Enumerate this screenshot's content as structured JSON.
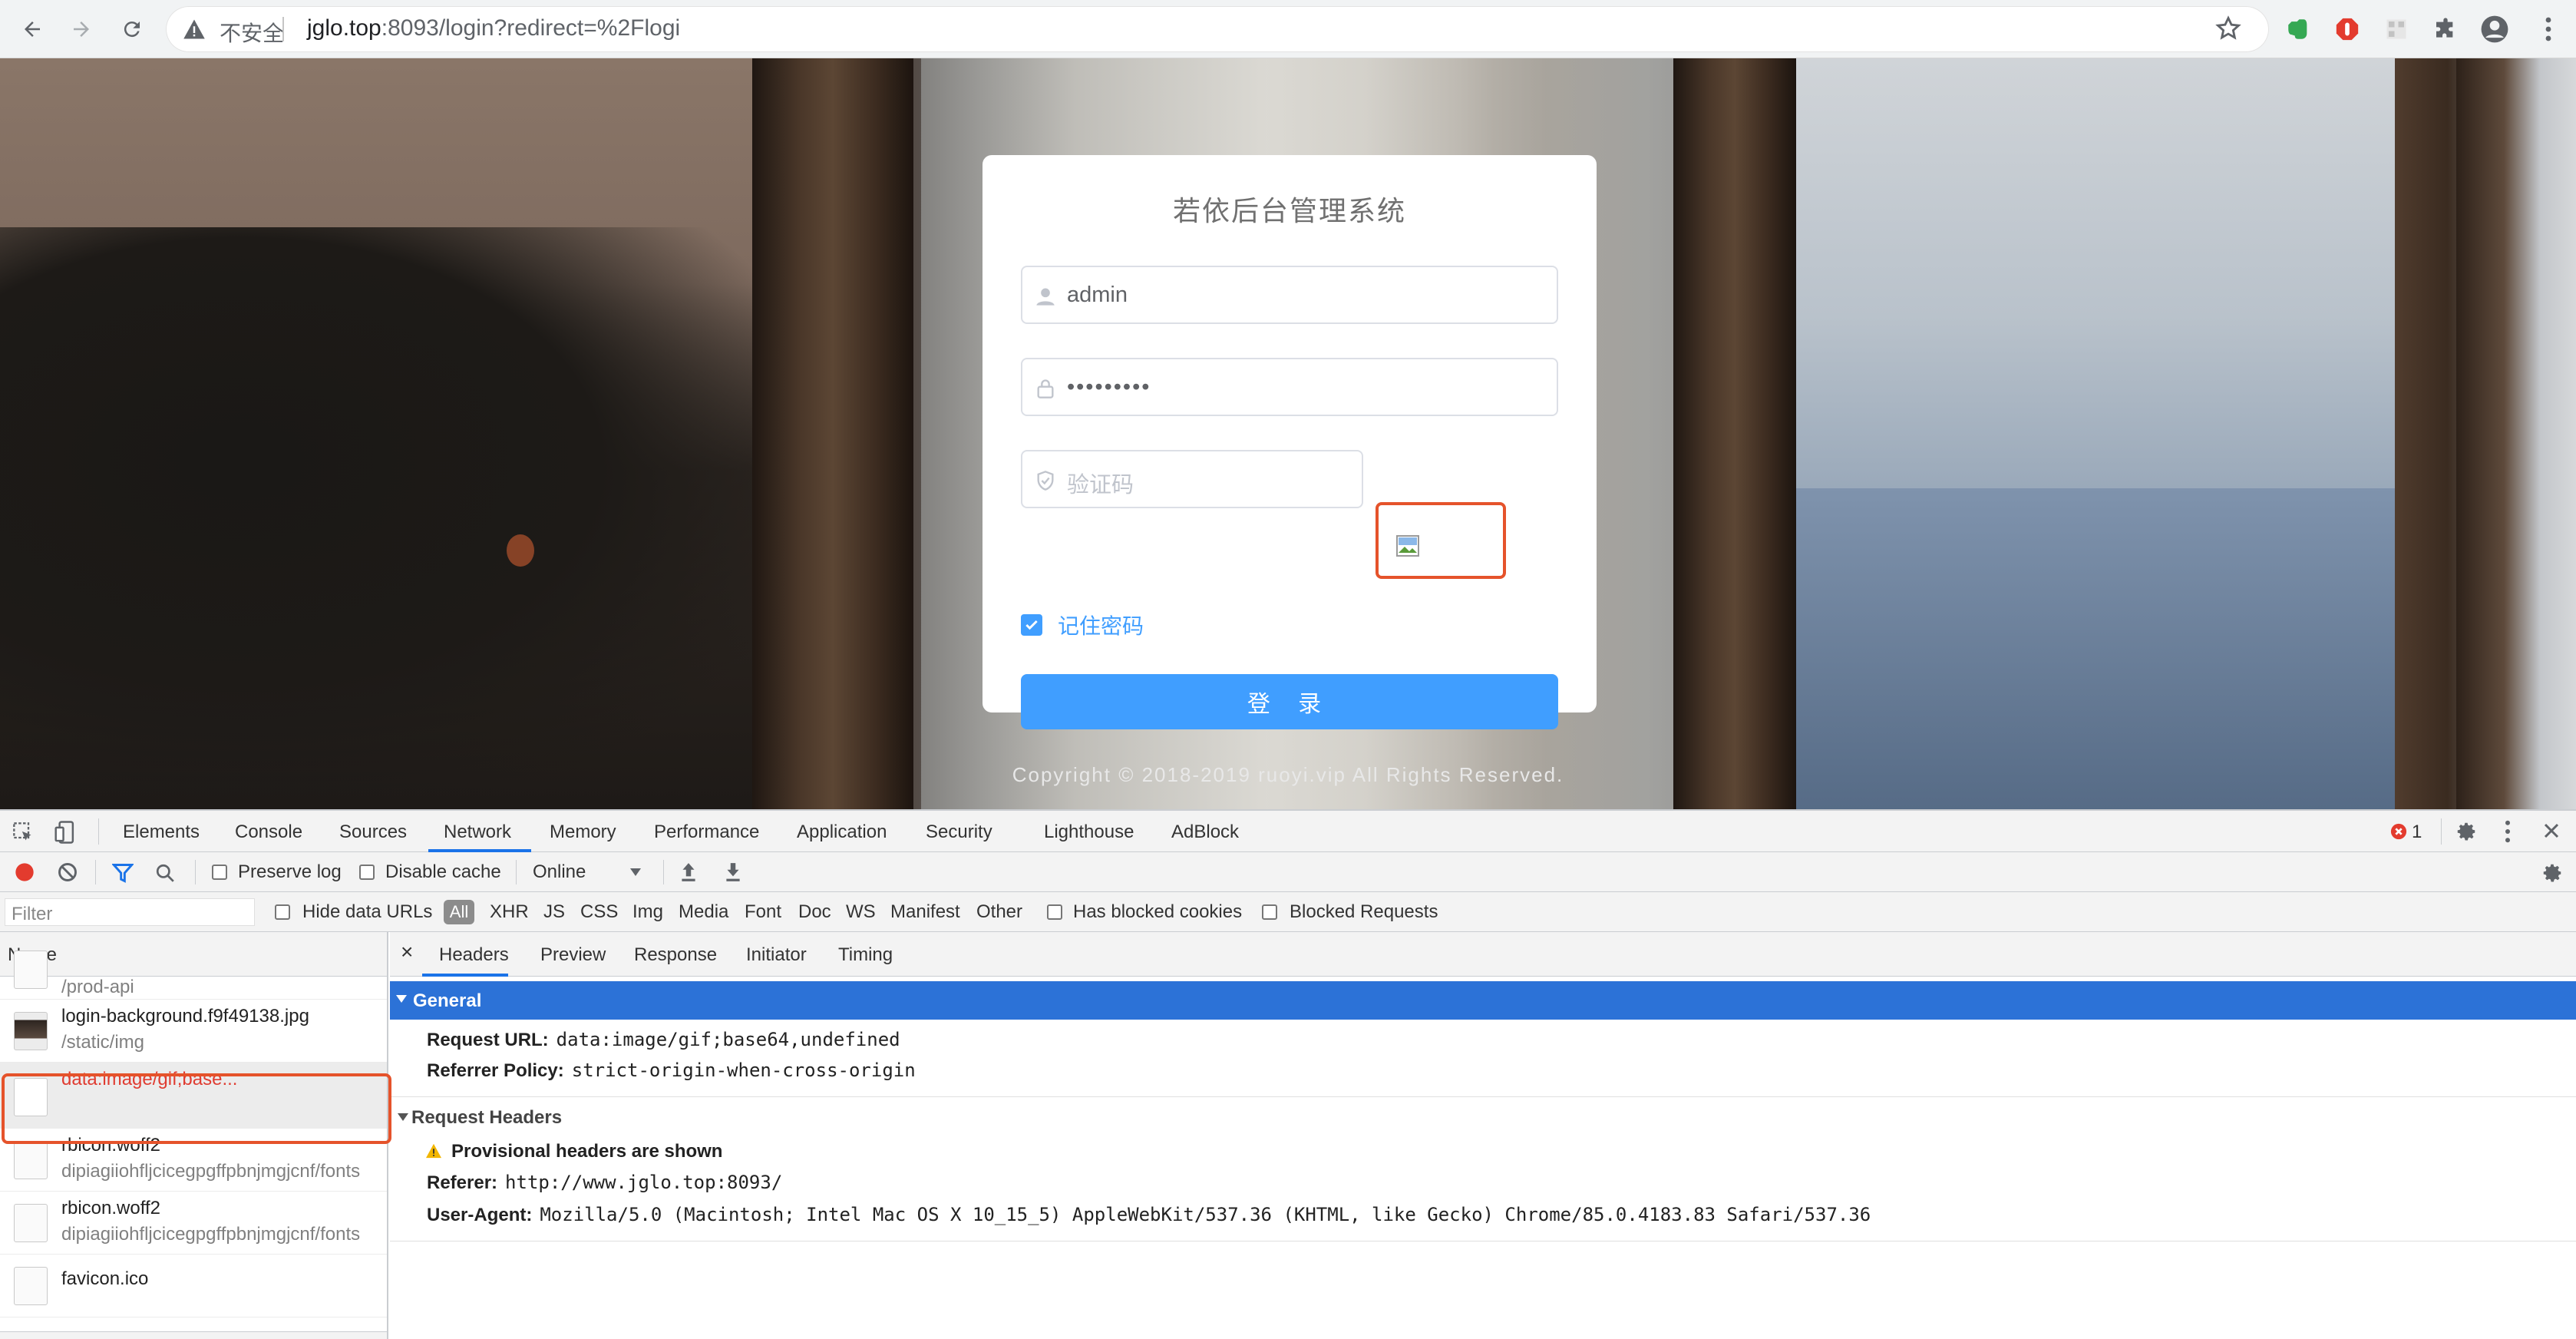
{
  "browser": {
    "security_label": "不安全",
    "url_host": "jglo.top",
    "url_rest": ":8093/login?redirect=%2Flogi"
  },
  "login": {
    "title": "若依后台管理系统",
    "username_value": "admin",
    "password_value": "•••••••••",
    "captcha_placeholder": "验证码",
    "remember_label": "记住密码",
    "login_button": "登 录"
  },
  "footer": {
    "copyright": "Copyright © 2018-2019 ruoyi.vip All Rights Reserved."
  },
  "devtools": {
    "tabs": [
      "Elements",
      "Console",
      "Sources",
      "Network",
      "Memory",
      "Performance",
      "Application",
      "Security",
      "Lighthouse",
      "AdBlock"
    ],
    "error_count": "1",
    "toolbar": {
      "preserve_log": "Preserve log",
      "disable_cache": "Disable cache",
      "throttle": "Online"
    },
    "filter": {
      "placeholder": "Filter",
      "hide_data_urls": "Hide data URLs",
      "all": "All",
      "types": [
        "XHR",
        "JS",
        "CSS",
        "Img",
        "Media",
        "Font",
        "Doc",
        "WS",
        "Manifest",
        "Other"
      ],
      "has_blocked_cookies": "Has blocked cookies",
      "blocked_requests": "Blocked Requests"
    },
    "requests": {
      "header": "Name",
      "rows": [
        {
          "name": "",
          "sub": "/prod-api"
        },
        {
          "name": "login-background.f9f49138.jpg",
          "sub": "/static/img"
        },
        {
          "name": "data:image/gif;base...",
          "sub": ""
        },
        {
          "name": "rbicon.woff2",
          "sub": "dipiagiiohfljcicegpgffpbnjmgjcnf/fonts"
        },
        {
          "name": "rbicon.woff2",
          "sub": "dipiagiiohfljcicegpgffpbnjmgjcnf/fonts"
        },
        {
          "name": "favicon.ico",
          "sub": ""
        }
      ]
    },
    "detail": {
      "close": "×",
      "tabs": [
        "Headers",
        "Preview",
        "Response",
        "Initiator",
        "Timing"
      ],
      "general_title": "General",
      "general": [
        {
          "key": "Request URL:",
          "value": "data:image/gif;base64,undefined"
        },
        {
          "key": "Referrer Policy:",
          "value": "strict-origin-when-cross-origin"
        }
      ],
      "request_headers_title": "Request Headers",
      "provisional_note": "Provisional headers are shown",
      "request_headers": [
        {
          "key": "Referer:",
          "value": "http://www.jglo.top:8093/"
        },
        {
          "key": "User-Agent:",
          "value": "Mozilla/5.0 (Macintosh; Intel Mac OS X 10_15_5) AppleWebKit/537.36 (KHTML, like Gecko) Chrome/85.0.4183.83 Safari/537.36"
        }
      ]
    }
  },
  "colors": {
    "primary": "#409eff",
    "highlight": "#e5532b",
    "devtools_selected": "#2c72d7"
  }
}
